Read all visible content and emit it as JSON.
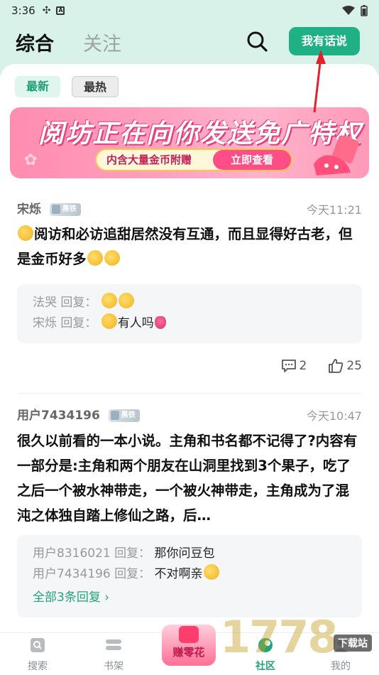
{
  "status": {
    "time": "3:36"
  },
  "header": {
    "tab_main": "综合",
    "tab_follow": "关注",
    "talk_button": "我有话说"
  },
  "filters": {
    "latest": "最新",
    "hot": "最热"
  },
  "banner": {
    "title": "阅坊正在向你发送免广特权",
    "subtitle": "内含大量金币附赠",
    "cta": "立即查看"
  },
  "posts": [
    {
      "user": "宋烁",
      "badge": "黑铁",
      "time": "今天11:21",
      "body": "阅访和必访追甜居然没有互通，而且显得好古老，但是金币好多",
      "replies": [
        {
          "user": "法哭",
          "action": "回复：",
          "text": ""
        },
        {
          "user": "宋烁",
          "action": "回复：",
          "text": "有人吗"
        }
      ],
      "comments": "2",
      "likes": "25"
    },
    {
      "user": "用户7434196",
      "badge": "黑铁",
      "time": "今天10:47",
      "body": "很久以前看的一本小说。主角和书名都不记得了?内容有一部分是:主角和两个朋友在山洞里找到3个果子，吃了之后一个被水神带走，一个被火神带走，主角成为了混沌之体独自踏上修仙之路，后…",
      "replies": [
        {
          "user": "用户8316021",
          "action": "回复：",
          "text": "那你问豆包"
        },
        {
          "user": "用户7434196",
          "action": "回复：",
          "text": "不对啊亲"
        }
      ],
      "all_replies": "全部3条回复 ›"
    }
  ],
  "nav": {
    "search": "搜索",
    "shelf": "书架",
    "earn": "赚零花",
    "community": "社区",
    "mine": "我的"
  },
  "watermark": {
    "logo": "1778",
    "site": "下载站"
  },
  "colors": {
    "accent": "#1fb085",
    "background": "#d8f2ea"
  }
}
